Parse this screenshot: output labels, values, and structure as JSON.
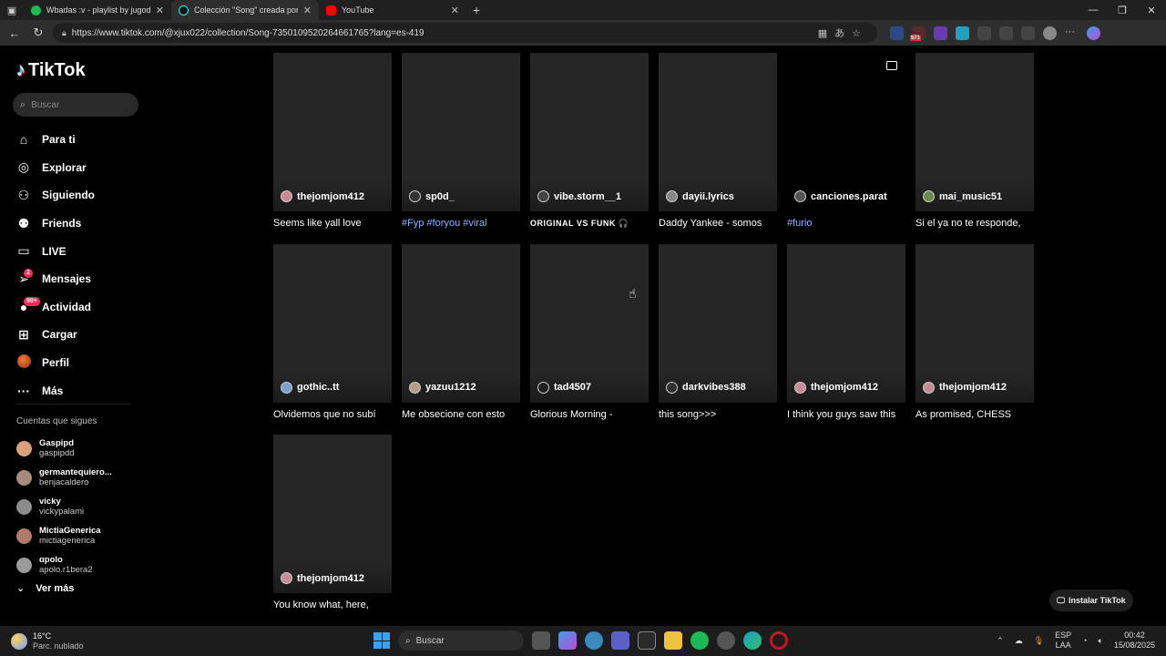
{
  "browser": {
    "tabs": [
      {
        "title": "Wbadas :v - playlist by jugodeuva",
        "favicon_color": "#1db954"
      },
      {
        "title": "Colección \"Song\" creada por xjux",
        "favicon_color": "#111111"
      },
      {
        "title": "YouTube",
        "favicon_color": "#ff0000"
      }
    ],
    "url": "https://www.tiktok.com/@xjux022/collection/Song-7350109520264661765?lang=es-419",
    "ext_badge": "571"
  },
  "sidebar": {
    "logo": "TikTok",
    "search_placeholder": "Buscar",
    "menu": [
      {
        "label": "Para ti",
        "icon": "home-icon",
        "glyph": "⌂"
      },
      {
        "label": "Explorar",
        "icon": "compass-icon",
        "glyph": "◎"
      },
      {
        "label": "Siguiendo",
        "icon": "following-icon",
        "glyph": "⚇"
      },
      {
        "label": "Friends",
        "icon": "friends-icon",
        "glyph": "⚉"
      },
      {
        "label": "LIVE",
        "icon": "live-icon",
        "glyph": "▭"
      },
      {
        "label": "Mensajes",
        "icon": "messages-icon",
        "glyph": "➢",
        "badge": "2"
      },
      {
        "label": "Actividad",
        "icon": "activity-icon",
        "glyph": "●",
        "badge": "99+"
      },
      {
        "label": "Cargar",
        "icon": "upload-icon",
        "glyph": "⊞"
      },
      {
        "label": "Perfil",
        "icon": "profile-icon",
        "glyph": ""
      },
      {
        "label": "Más",
        "icon": "more-icon",
        "glyph": "···"
      }
    ],
    "following_title": "Cuentas que sigues",
    "following": [
      {
        "name": "Gaspipd",
        "handle": "gaspipdd",
        "color": "#d9a07a"
      },
      {
        "name": "germantequiero...",
        "handle": "benjacaldero",
        "color": "#a58c7d"
      },
      {
        "name": "vicky",
        "handle": "vickypalami",
        "color": "#8c8c8c"
      },
      {
        "name": "MictiaGenerica",
        "handle": "mictiagenerica",
        "color": "#b27a6a"
      },
      {
        "name": "ɑpolo",
        "handle": "apolo.r1bera2",
        "color": "#9a9a9a"
      }
    ],
    "see_more": "Ver más"
  },
  "videos": [
    {
      "user": "thejomjom412",
      "caption": "Seems like yall love",
      "style": "",
      "avatar": "#c98a9a",
      "empty": false
    },
    {
      "user": "sp0d_",
      "caption": "#Fyp #foryou #viral",
      "style": "link",
      "avatar": "#333333",
      "empty": false
    },
    {
      "user": "vibe.storm__1",
      "caption": "ORIGINAL VS FUNK 🎧",
      "style": "caps",
      "avatar": "#444444",
      "empty": false
    },
    {
      "user": "dayii.lyrics",
      "caption": "Daddy Yankee - somos",
      "style": "",
      "avatar": "#888888",
      "empty": false
    },
    {
      "user": "canciones.parat",
      "caption": "#furio",
      "style": "link",
      "avatar": "#555555",
      "empty": true
    },
    {
      "user": "mai_music51",
      "caption": "Si el ya no te responde,",
      "style": "",
      "avatar": "#6a8a4a",
      "empty": false
    },
    {
      "user": "gothic..tt",
      "caption": "Olvidemos que no subí",
      "style": "",
      "avatar": "#7aa0d0",
      "empty": false
    },
    {
      "user": "yazuu1212",
      "caption": "Me obsecione con esto",
      "style": "",
      "avatar": "#b89a8a",
      "empty": false
    },
    {
      "user": "tad4507",
      "caption": "Glorious Morning -",
      "style": "",
      "avatar": "#222222",
      "empty": false
    },
    {
      "user": "darkvibes388",
      "caption": "this song>>>",
      "style": "",
      "avatar": "#333333",
      "empty": false
    },
    {
      "user": "thejomjom412",
      "caption": "I think you guys saw this",
      "style": "",
      "avatar": "#c98a9a",
      "empty": false
    },
    {
      "user": "thejomjom412",
      "caption": "As promised, CHESS",
      "style": "",
      "avatar": "#c98a9a",
      "empty": false
    },
    {
      "user": "thejomjom412",
      "caption": "You know what, here,",
      "style": "",
      "avatar": "#c98a9a",
      "empty": false
    }
  ],
  "install_button": "Instalar TikTok",
  "taskbar": {
    "temperature": "16°C",
    "weather": "Parc. nublado",
    "search_placeholder": "Buscar",
    "lang_line1": "ESP",
    "lang_line2": "LAA",
    "time": "00:42",
    "date": "15/08/2025"
  }
}
